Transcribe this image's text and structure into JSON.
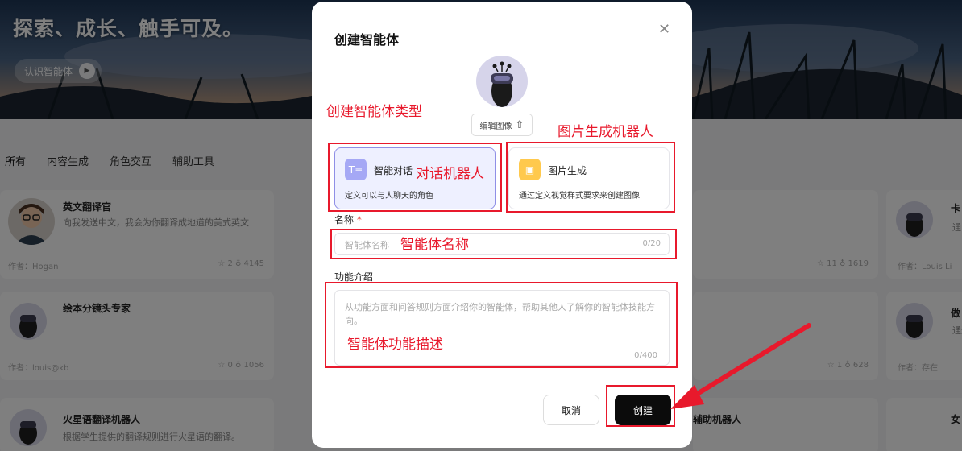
{
  "banner": {
    "title": "探索、成长、触手可及。",
    "button_label": "认识智能体"
  },
  "tabs": [
    "所有",
    "内容生成",
    "角色交互",
    "辅助工具"
  ],
  "cards": [
    {
      "name": "英文翻译官",
      "desc": "向我发送中文，我会为你翻译成地道的美式英文",
      "author": "作者：Hogan",
      "stats": "☆ 2 ♁ 4145"
    },
    {
      "name": "绘本分镜头专家",
      "desc": "",
      "author": "作者：louis@kb",
      "stats": "☆ 0 ♁ 1056"
    },
    {
      "name": "火星语翻译机器人",
      "desc": "根据学生提供的翻译规则进行火星语的翻译。",
      "author": "",
      "stats": ""
    }
  ],
  "right_cards": [
    {
      "stats": "☆ 11 ♁ 1619",
      "author": "作者：Louis Li",
      "name": "卡",
      "desc": "通"
    },
    {
      "stats": "☆ 1 ♁ 628",
      "author": "作者：存在",
      "name": "做",
      "desc": "通过"
    },
    {
      "name": "女",
      "partial": "辅助机器人"
    }
  ],
  "modal": {
    "title": "创建智能体",
    "edit_image_label": "编辑图像",
    "types": [
      {
        "label": "智能对话",
        "desc": "定义可以与人聊天的角色",
        "icon": "chat-doc-icon",
        "selected": true
      },
      {
        "label": "图片生成",
        "desc": "通过定义视觉样式要求来创建图像",
        "icon": "image-icon",
        "selected": false
      }
    ],
    "name_label": "名称",
    "name_required": "*",
    "name_placeholder": "智能体名称",
    "name_counter": "0/20",
    "intro_label": "功能介绍",
    "intro_placeholder": "从功能方面和问答规则方面介绍你的智能体，帮助其他人了解你的智能体技能方向。",
    "intro_counter": "0/400",
    "cancel_label": "取消",
    "create_label": "创建"
  },
  "annotations": {
    "type_section": "创建智能体类型",
    "image_bot": "图片生成机器人",
    "chat_bot": "对话机器人",
    "agent_name": "智能体名称",
    "agent_desc": "智能体功能描述"
  },
  "colors": {
    "annotation": "#e8192c",
    "accent": "#5b5bd6",
    "primary_button": "#0b0b0b"
  }
}
